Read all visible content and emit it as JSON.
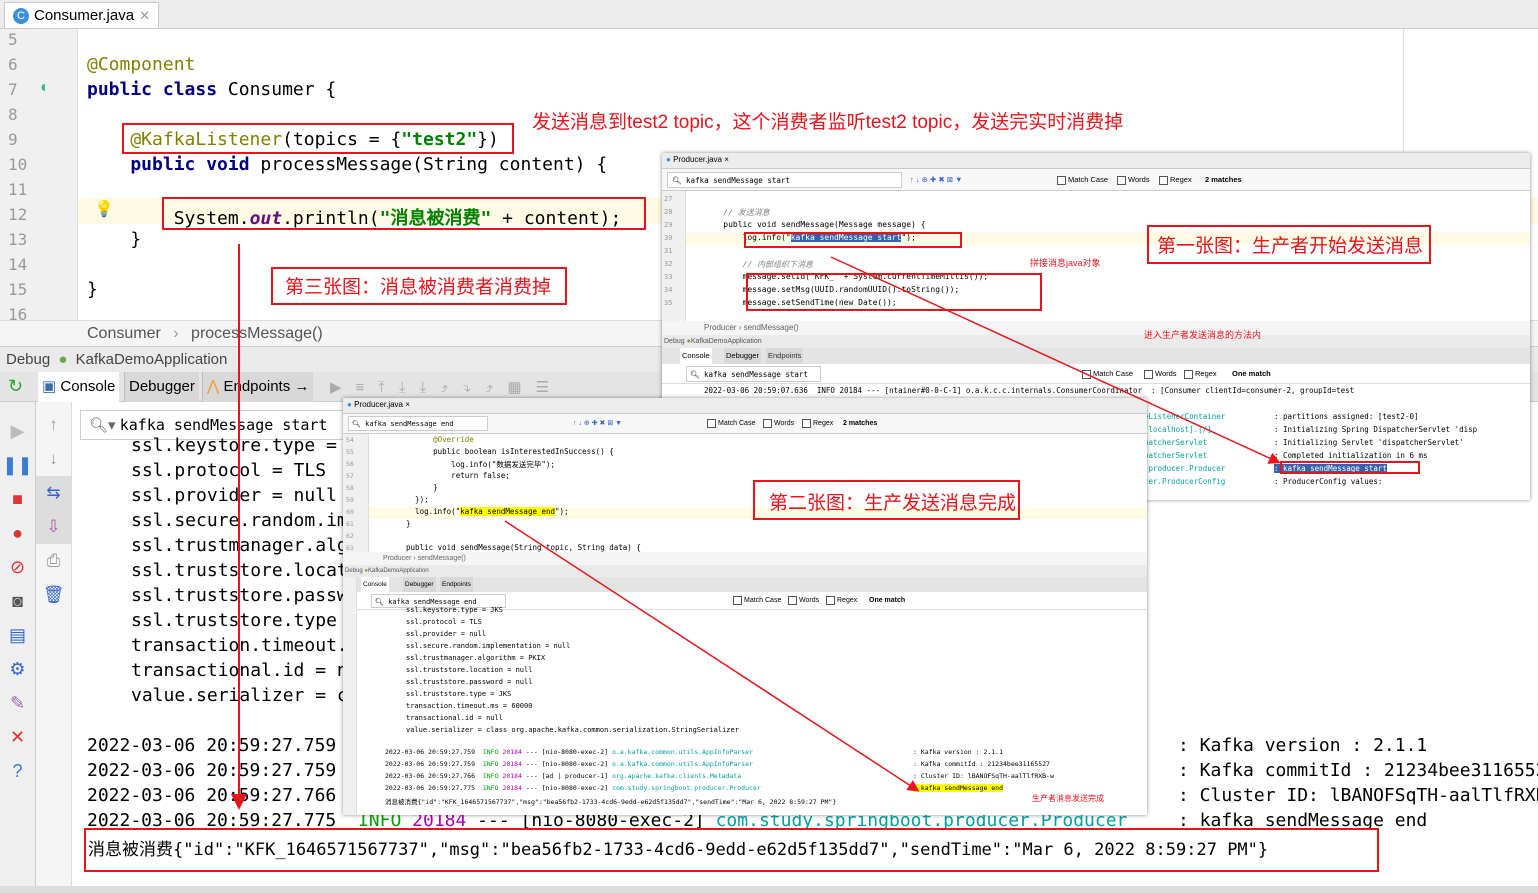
{
  "editor": {
    "tab": "Consumer.java",
    "tab_icon": "class-c-icon",
    "line_numbers": [
      "5",
      "6",
      "7",
      "8",
      "9",
      "10",
      "11",
      "12",
      "13",
      "14",
      "15",
      "16"
    ],
    "lines": [
      [],
      [
        {
          "t": "@Component",
          "c": "an"
        }
      ],
      [
        {
          "t": "public ",
          "c": "kw"
        },
        {
          "t": "class ",
          "c": "kw"
        },
        {
          "t": "Consumer {",
          "c": ""
        }
      ],
      [],
      [
        {
          "t": "    @KafkaListener",
          "c": "an"
        },
        {
          "t": "(topics = {",
          "c": ""
        },
        {
          "t": "\"test2\"",
          "c": "st"
        },
        {
          "t": "})",
          "c": ""
        }
      ],
      [
        {
          "t": "    public void ",
          "c": "kw"
        },
        {
          "t": "processMessage(String content) {",
          "c": ""
        }
      ],
      [],
      [
        {
          "t": "        System.",
          "c": ""
        },
        {
          "t": "out",
          "c": "fld"
        },
        {
          "t": ".println(",
          "c": ""
        },
        {
          "t": "\"消息被消费\"",
          "c": "st"
        },
        {
          "t": " + content);",
          "c": ""
        }
      ],
      [
        {
          "t": "    }",
          "c": ""
        }
      ],
      [],
      [
        {
          "t": "}",
          "c": ""
        }
      ],
      []
    ],
    "breadcrumb": [
      "Consumer",
      "processMessage()"
    ]
  },
  "debug": {
    "label": "Debug",
    "app": "KafkaDemoApplication",
    "tabs": [
      "Console",
      "Debugger",
      "Endpoints"
    ],
    "search": "kafka sendMessage start",
    "console_lines": [
      "ssl.keystore.type = JKS",
      "ssl.protocol = TLS",
      "ssl.provider = null",
      "ssl.secure.random.implementation = null",
      "ssl.trustmanager.algorithm = PKIX",
      "ssl.truststore.location = null",
      "ssl.truststore.password = null",
      "ssl.truststore.type = JKS",
      "transaction.timeout.ms = 60000",
      "transactional.id = null",
      "value.serializer = class org.apache.kafka.common.serialization.StringSerializer"
    ],
    "log_lines": [
      {
        "time": "2022-03-06 20:59:27.759",
        "level": "INFO",
        "pid": "20184",
        "thread": "--- [nio-8080-exec-2]",
        "logger": "o.a.kafka.common.utils.AppInfoParser",
        "msg": ": Kafka version : 2.1.1"
      },
      {
        "time": "2022-03-06 20:59:27.759",
        "level": "INFO",
        "pid": "20184",
        "thread": "--- [nio-8080-exec-2]",
        "logger": "o.a.kafka.common.utils.AppInfoParser",
        "msg": ": Kafka commitId : 21234bee31165527"
      },
      {
        "time": "2022-03-06 20:59:27.766",
        "level": "INFO",
        "pid": "20184",
        "thread": "--- [ad | producer-1]",
        "logger": "org.apache.kafka.clients.Metadata",
        "msg": ": Cluster ID: lBANOFSqTH-aalTlfRXB-w"
      },
      {
        "time": "2022-03-06 20:59:27.775",
        "level": "INFO",
        "pid": "20184",
        "thread": "--- [nio-8080-exec-2]",
        "logger": "com.study.springboot.producer.Producer",
        "msg": ": kafka sendMessage end"
      }
    ],
    "consumed": "消息被消费{\"id\":\"KFK_1646571567737\",\"msg\":\"bea56fb2-1733-4cd6-9edd-e62d5f135dd7\",\"sendTime\":\"Mar 6, 2022 8:59:27 PM\"}"
  },
  "shot1": {
    "tab": "Producer.java",
    "search": "kafka sendMessage start",
    "match_case": "Match Case",
    "words": "Words",
    "regex": "Regex",
    "matches": "2 matches",
    "line_numbers": [
      "27",
      "28",
      "29",
      "30",
      "31",
      "32",
      "33",
      "34",
      "35"
    ],
    "code": [
      "",
      "    // 发送消息",
      "    public void sendMessage(Message message) {",
      "        log.info(\"kafka sendMessage start\");",
      "",
      "        // 内部组织下消息",
      "        message.setId(\"KFK_\" + System.currentTimeMillis());",
      "        message.setMsg(UUID.randomUUID().toString());",
      "        message.setSendTime(new Date());"
    ],
    "breadcrumb": [
      "Producer",
      "sendMessage()"
    ],
    "debug": "Debug",
    "app": "KafkaDemoApplication",
    "tabs": [
      "Console",
      "Debugger",
      "Endpoints"
    ],
    "console_search": "kafka sendMessage start",
    "console_matches": "One match",
    "log_first": "2022-03-06 20:59:07.636  INFO 20184 --- [ntainer#0-0-C-1] o.a.k.c.c.internals.ConsumerCoordinator  : [Consumer clientId=consumer-2, groupId=test",
    "log_right": [
      {
        "logger": "eListenerContainer",
        "msg": ": partitions assigned: [test2-0]"
      },
      {
        "logger": "[localhost].[/]",
        "msg": ": Initializing Spring DispatcherServlet 'disp"
      },
      {
        "logger": "patcherServlet",
        "msg": ": Initializing Servlet 'dispatcherServlet'"
      },
      {
        "logger": "patcherServlet",
        "msg": ": Completed initialization in 6 ms"
      },
      {
        "logger": ".producer.Producer",
        "msg": ": kafka sendMessage start"
      },
      {
        "logger": "cer.ProducerConfig",
        "msg": ": ProducerConfig values:"
      }
    ]
  },
  "shot2": {
    "tab": "Producer.java",
    "search": "kafka sendMessage end",
    "match_case": "Match Case",
    "words": "Words",
    "regex": "Regex",
    "matches": "2 matches",
    "line_numbers": [
      "54",
      "55",
      "56",
      "57",
      "58",
      "59",
      "60",
      "61",
      "62",
      "63"
    ],
    "code": [
      "        @Override",
      "        public boolean isInterestedInSuccess() {",
      "            log.info(\"数据发送完毕\");",
      "            return false;",
      "        }",
      "    });",
      "    log.info(\"kafka sendMessage end\");",
      "  }",
      "",
      "  public void sendMessage(String topic, String data) {"
    ],
    "breadcrumb": [
      "Producer",
      "sendMessage()"
    ],
    "debug": "Debug",
    "app": "KafkaDemoApplication",
    "tabs": [
      "Console",
      "Debugger",
      "Endpoints"
    ],
    "console_search": "kafka sendMessage end",
    "console_matches": "One match"
  },
  "annotations": {
    "top": "发送消息到test2 topic，这个消费者监听test2 topic，发送完实时消费掉",
    "first": "第一张图：生产者开始发送消息",
    "second": "第二张图：生产发送消息完成",
    "third": "第三张图：消息被消费者消费掉",
    "assemble": "拼接消息java对象",
    "enter": "进入生产者发送消息的方法内",
    "done": "生产者消息发送完成"
  },
  "colors": {
    "annotation": "#e8141c",
    "keyword": "#000080",
    "string": "#008000",
    "highlight": "#ffff00",
    "selection": "#3a5fa8"
  }
}
